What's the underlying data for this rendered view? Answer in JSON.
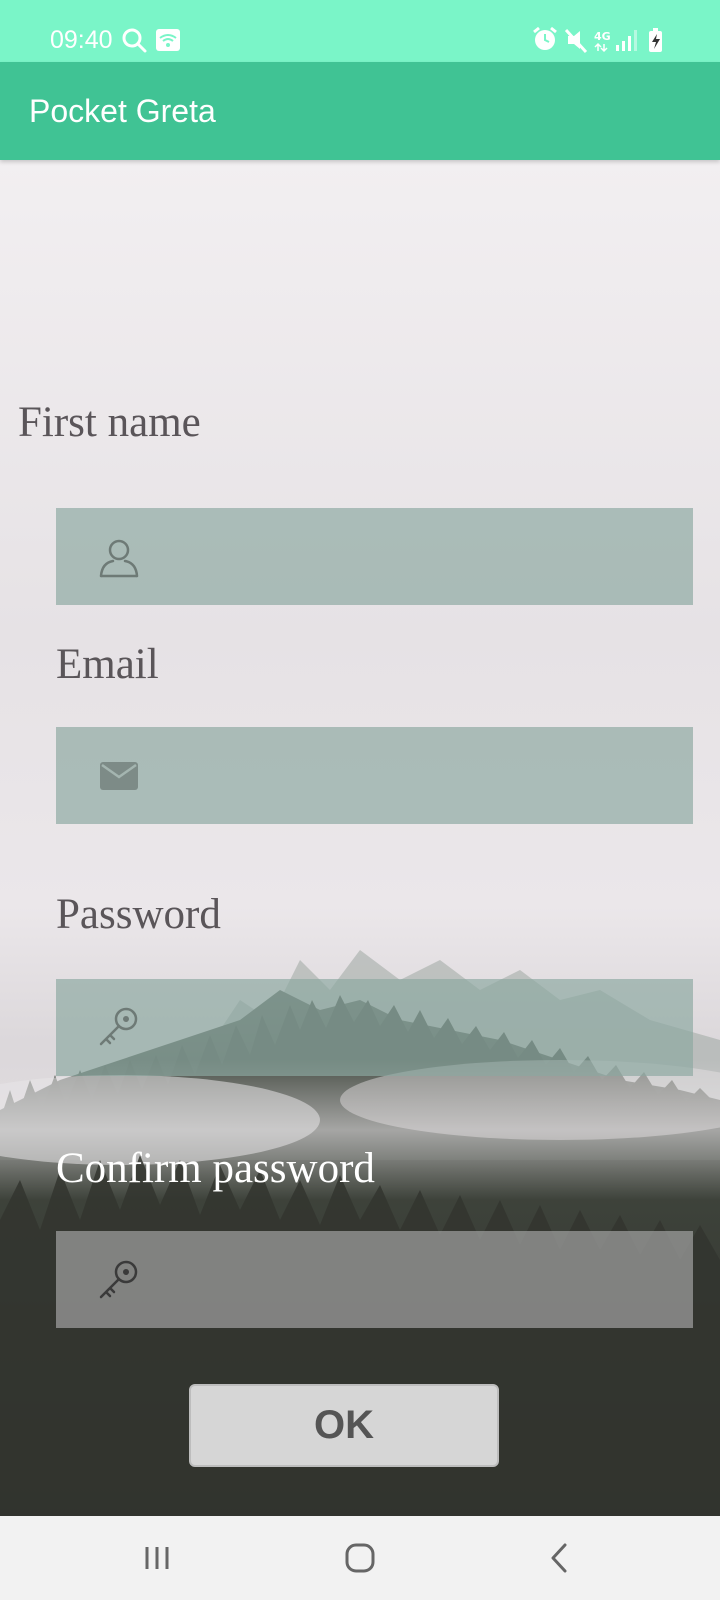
{
  "status_bar": {
    "time": "09:40",
    "network_label": "4G",
    "icons": [
      "search-icon",
      "wifi-calling-icon",
      "alarm-icon",
      "mute-icon",
      "network-4g-icon",
      "signal-icon",
      "battery-charging-icon"
    ]
  },
  "app_bar": {
    "title": "Pocket Greta"
  },
  "form": {
    "first_name": {
      "label": "First name",
      "icon": "person-icon",
      "value": ""
    },
    "email": {
      "label": "Email",
      "icon": "mail-icon",
      "value": ""
    },
    "password": {
      "label": "Password",
      "icon": "key-icon",
      "value": ""
    },
    "confirm_password": {
      "label": "Confirm password",
      "icon": "key-icon",
      "value": ""
    },
    "ok_label": "OK"
  },
  "nav_bar": {
    "icons": [
      "recent-apps-icon",
      "home-icon",
      "back-icon"
    ]
  },
  "colors": {
    "status_bar": "#7af5c8",
    "app_bar": "#40c394",
    "field_green": "#8ca8a0",
    "field_gray": "#a0a0a0",
    "ok_button": "#d6d6d6"
  }
}
